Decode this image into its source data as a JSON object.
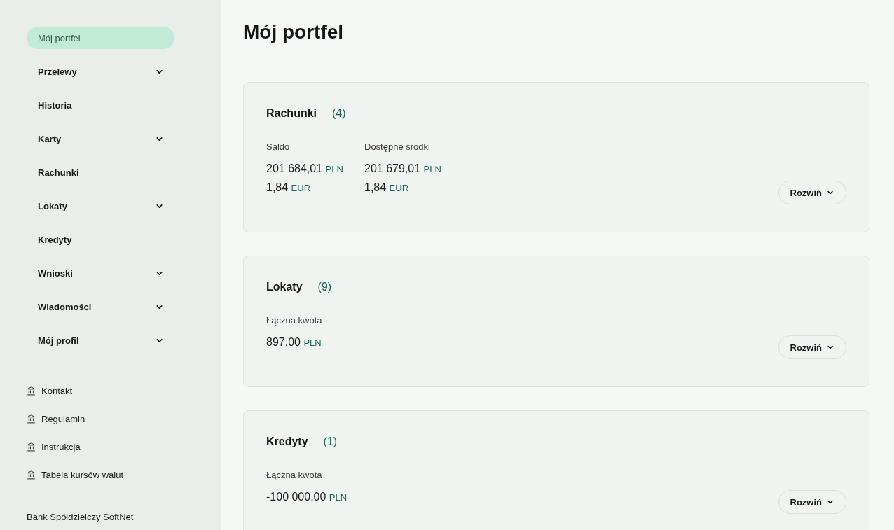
{
  "sidebar": {
    "nav": [
      {
        "label": "Mój portfel",
        "selected": true,
        "expandable": false
      },
      {
        "label": "Przelewy",
        "selected": false,
        "expandable": true
      },
      {
        "label": "Historia",
        "selected": false,
        "expandable": false
      },
      {
        "label": "Karty",
        "selected": false,
        "expandable": true
      },
      {
        "label": "Rachunki",
        "selected": false,
        "expandable": false
      },
      {
        "label": "Lokaty",
        "selected": false,
        "expandable": true
      },
      {
        "label": "Kredyty",
        "selected": false,
        "expandable": false
      },
      {
        "label": "Wnioski",
        "selected": false,
        "expandable": true
      },
      {
        "label": "Wiadomości",
        "selected": false,
        "expandable": true
      },
      {
        "label": "Mój profil",
        "selected": false,
        "expandable": true
      }
    ],
    "links": [
      "Kontakt",
      "Regulamin",
      "Instrukcja",
      "Tabela kursów walut"
    ],
    "footer": "Bank Spółdzielczy SoftNet"
  },
  "page_title": "Mój portfel",
  "cards": [
    {
      "title": "Rachunki",
      "count": "(4)",
      "columns": [
        {
          "label": "Saldo",
          "amounts": [
            {
              "value": "201 684,01",
              "currency": "PLN"
            },
            {
              "value": "1,84",
              "currency": "EUR"
            }
          ]
        },
        {
          "label": "Dostępne środki",
          "amounts": [
            {
              "value": "201 679,01",
              "currency": "PLN"
            },
            {
              "value": "1,84",
              "currency": "EUR"
            }
          ]
        }
      ],
      "button": "Rozwiń"
    },
    {
      "title": "Lokaty",
      "count": "(9)",
      "columns": [
        {
          "label": "Łączna kwota",
          "amounts": [
            {
              "value": "897,00",
              "currency": "PLN"
            }
          ]
        }
      ],
      "button": "Rozwiń"
    },
    {
      "title": "Kredyty",
      "count": "(1)",
      "columns": [
        {
          "label": "Łączna kwota",
          "amounts": [
            {
              "value": "-100 000,00",
              "currency": "PLN"
            }
          ]
        }
      ],
      "button": "Rozwiń"
    }
  ]
}
